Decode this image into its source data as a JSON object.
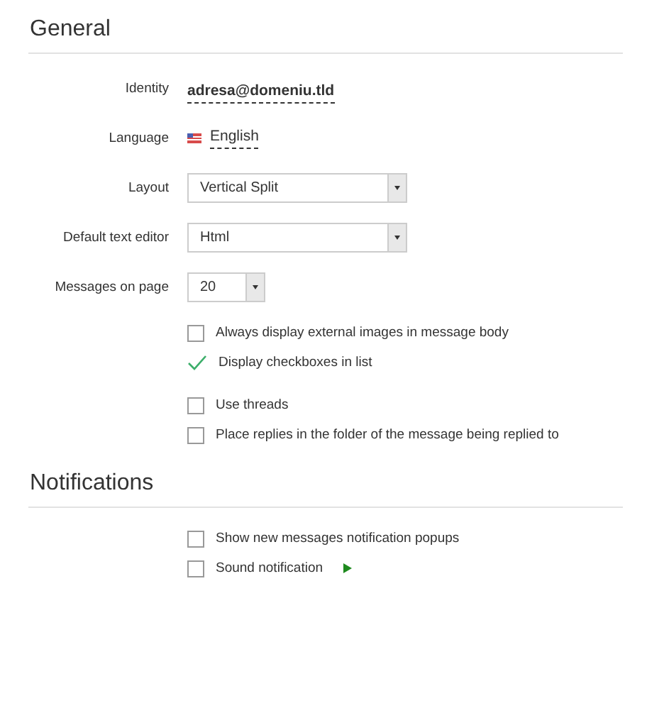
{
  "sections": [
    {
      "title": "General",
      "fields": [
        {
          "kind": "identity",
          "label": "Identity",
          "value": "adresa@domeniu.tld"
        },
        {
          "kind": "language",
          "label": "Language",
          "value": "English"
        },
        {
          "kind": "select",
          "label": "Layout",
          "value": "Vertical Split"
        },
        {
          "kind": "select",
          "label": "Default text editor",
          "value": "Html"
        },
        {
          "kind": "short-select",
          "label": "Messages on page",
          "value": "20"
        }
      ],
      "option_groups": [
        [
          {
            "kind": "checkbox",
            "label": "Always display external images in message body",
            "checked": false
          },
          {
            "kind": "checkbox",
            "label": "Display checkboxes in list",
            "checked": true
          }
        ],
        [
          {
            "kind": "checkbox",
            "label": "Use threads",
            "checked": false
          },
          {
            "kind": "checkbox",
            "label": "Place replies in the folder of the message being replied to",
            "checked": false
          }
        ]
      ]
    },
    {
      "title": "Notifications",
      "option_groups": [
        [
          {
            "kind": "checkbox",
            "label": "Show new messages notification popups",
            "checked": false
          },
          {
            "kind": "sound",
            "label": "Sound notification",
            "checked": false
          }
        ]
      ]
    }
  ]
}
